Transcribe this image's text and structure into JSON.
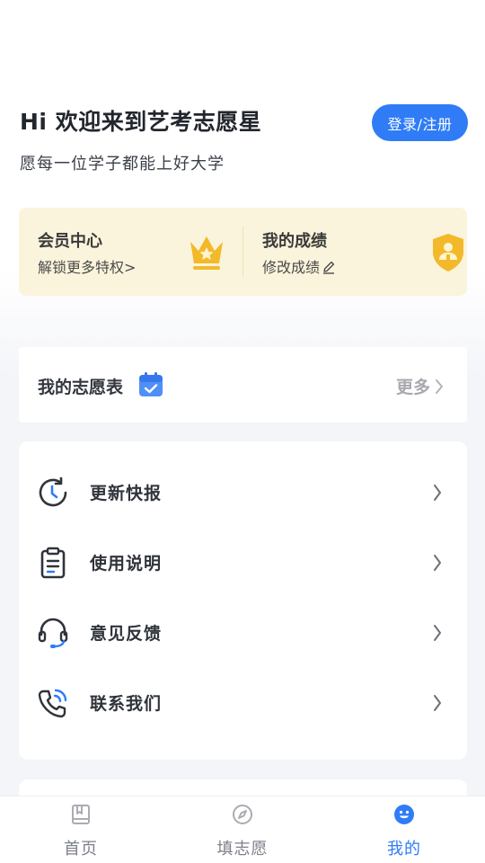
{
  "header": {
    "greeting": "Hi 欢迎来到艺考志愿星",
    "subtitle": "愿每一位学子都能上好大学",
    "login_button": "登录/注册"
  },
  "member_card": {
    "left": {
      "title": "会员中心",
      "subtitle": "解锁更多特权>",
      "icon": "crown-icon"
    },
    "right": {
      "title": "我的成绩",
      "subtitle": "修改成绩",
      "icon": "shield-user-icon"
    }
  },
  "volunteer_table": {
    "title": "我的志愿表",
    "icon": "calendar-check-icon",
    "more_label": "更多"
  },
  "menu": {
    "items": [
      {
        "label": "更新快报",
        "icon": "clock-refresh-icon"
      },
      {
        "label": "使用说明",
        "icon": "clipboard-icon"
      },
      {
        "label": "意见反馈",
        "icon": "headset-icon"
      },
      {
        "label": "联系我们",
        "icon": "phone-call-icon"
      }
    ]
  },
  "tabbar": {
    "tabs": [
      {
        "label": "首页",
        "icon": "book-icon",
        "active": false
      },
      {
        "label": "填志愿",
        "icon": "compass-icon",
        "active": false
      },
      {
        "label": "我的",
        "icon": "smile-face-icon",
        "active": true
      }
    ]
  },
  "colors": {
    "accent": "#2f7cf6",
    "member_card_bg": "#fbf4dc",
    "gold": "#f3b92a"
  }
}
